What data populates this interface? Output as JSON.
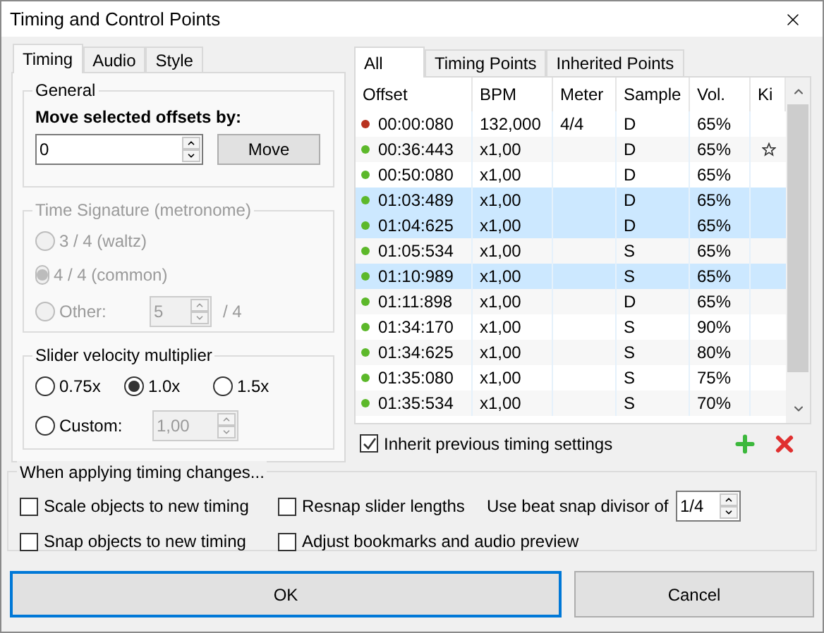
{
  "window": {
    "title": "Timing and Control Points"
  },
  "left_tabs": [
    {
      "label": "Timing",
      "selected": true
    },
    {
      "label": "Audio",
      "selected": false
    },
    {
      "label": "Style",
      "selected": false
    }
  ],
  "general": {
    "legend": "General",
    "label": "Move selected offsets by:",
    "offset_value": "0",
    "move_button": "Move"
  },
  "time_signature": {
    "legend": "Time Signature (metronome)",
    "disabled": true,
    "options": [
      {
        "label": "3 / 4 (waltz)",
        "selected": false
      },
      {
        "label": "4 / 4 (common)",
        "selected": true
      },
      {
        "label": "Other:",
        "selected": false,
        "value": "5",
        "suffix": "/ 4"
      }
    ]
  },
  "slider_velocity": {
    "legend": "Slider velocity multiplier",
    "options": [
      {
        "label": "0.75x",
        "selected": false
      },
      {
        "label": "1.0x",
        "selected": true
      },
      {
        "label": "1.5x",
        "selected": false
      }
    ],
    "custom": {
      "label": "Custom:",
      "selected": false,
      "value": "1,00",
      "disabled": true
    }
  },
  "list_tabs": [
    {
      "label": "All",
      "selected": true
    },
    {
      "label": "Timing Points",
      "selected": false
    },
    {
      "label": "Inherited Points",
      "selected": false
    }
  ],
  "table": {
    "columns": [
      "Offset",
      "BPM",
      "Meter",
      "Sample",
      "Vol.",
      "Ki"
    ],
    "rows": [
      {
        "kind": "timing",
        "offset": "00:00:080",
        "bpm": "132,000",
        "meter": "4/4",
        "sample": "D",
        "volume": "65%",
        "kiai": false,
        "selected": false
      },
      {
        "kind": "inherited",
        "offset": "00:36:443",
        "bpm": "x1,00",
        "sample": "D",
        "volume": "65%",
        "kiai": true,
        "selected": false
      },
      {
        "kind": "inherited",
        "offset": "00:50:080",
        "bpm": "x1,00",
        "sample": "D",
        "volume": "65%",
        "kiai": false,
        "selected": false
      },
      {
        "kind": "inherited",
        "offset": "01:03:489",
        "bpm": "x1,00",
        "sample": "D",
        "volume": "65%",
        "kiai": false,
        "selected": true
      },
      {
        "kind": "inherited",
        "offset": "01:04:625",
        "bpm": "x1,00",
        "sample": "D",
        "volume": "65%",
        "kiai": false,
        "selected": true
      },
      {
        "kind": "inherited",
        "offset": "01:05:534",
        "bpm": "x1,00",
        "sample": "S",
        "volume": "65%",
        "kiai": false,
        "selected": false
      },
      {
        "kind": "inherited",
        "offset": "01:10:989",
        "bpm": "x1,00",
        "sample": "S",
        "volume": "65%",
        "kiai": false,
        "selected": true
      },
      {
        "kind": "inherited",
        "offset": "01:11:898",
        "bpm": "x1,00",
        "sample": "D",
        "volume": "65%",
        "kiai": false,
        "selected": false
      },
      {
        "kind": "inherited",
        "offset": "01:34:170",
        "bpm": "x1,00",
        "sample": "S",
        "volume": "90%",
        "kiai": false,
        "selected": false
      },
      {
        "kind": "inherited",
        "offset": "01:34:625",
        "bpm": "x1,00",
        "sample": "S",
        "volume": "80%",
        "kiai": false,
        "selected": false
      },
      {
        "kind": "inherited",
        "offset": "01:35:080",
        "bpm": "x1,00",
        "sample": "S",
        "volume": "75%",
        "kiai": false,
        "selected": false
      },
      {
        "kind": "inherited",
        "offset": "01:35:534",
        "bpm": "x1,00",
        "sample": "S",
        "volume": "70%",
        "kiai": false,
        "selected": false
      }
    ]
  },
  "inherit": {
    "label": "Inherit previous timing settings",
    "checked": true
  },
  "apply": {
    "legend": "When applying timing changes...",
    "options": [
      {
        "label": "Scale objects to new timing",
        "checked": false
      },
      {
        "label": "Resnap slider lengths",
        "checked": false
      },
      {
        "label": "Snap objects to new timing",
        "checked": false
      },
      {
        "label": "Adjust bookmarks and audio preview",
        "checked": false
      }
    ],
    "divisor_label": "Use beat snap divisor of",
    "divisor_value": "1/4"
  },
  "buttons": [
    {
      "label": "OK",
      "default": true
    },
    {
      "label": "Cancel",
      "default": false
    }
  ]
}
